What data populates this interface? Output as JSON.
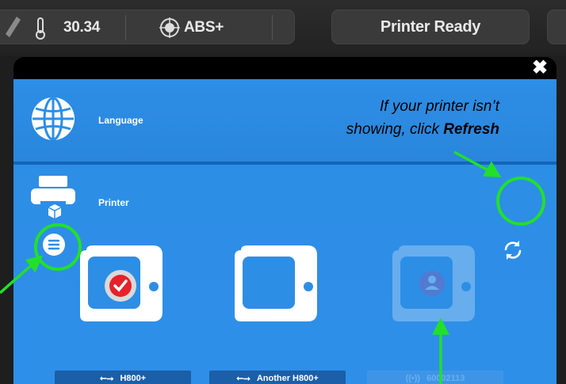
{
  "status_bar": {
    "temperature": "30.34",
    "filament": "ABS+",
    "status": "Printer Ready"
  },
  "modal": {
    "close_glyph": "✖",
    "sections": [
      {
        "label": "Language",
        "icon": "globe-icon"
      },
      {
        "label": "Printer",
        "icon": "printer-icon"
      }
    ],
    "printers": [
      {
        "name": "H800+",
        "connection": "usb-icon",
        "selected": true,
        "available": true
      },
      {
        "name": "Another H800+",
        "connection": "usb-icon",
        "selected": false,
        "available": true
      },
      {
        "name": "60002113",
        "connection": "wireless-icon",
        "selected": false,
        "available": false,
        "overlay": "user-icon"
      }
    ]
  },
  "annotation": {
    "line1": "If your printer isn’t",
    "line2_prefix": "showing, click ",
    "line2_bold": "Refresh"
  },
  "colors": {
    "panel_blue": "#2d8ee6",
    "highlight_green": "#22e02a",
    "selected_red": "#e8202a"
  }
}
